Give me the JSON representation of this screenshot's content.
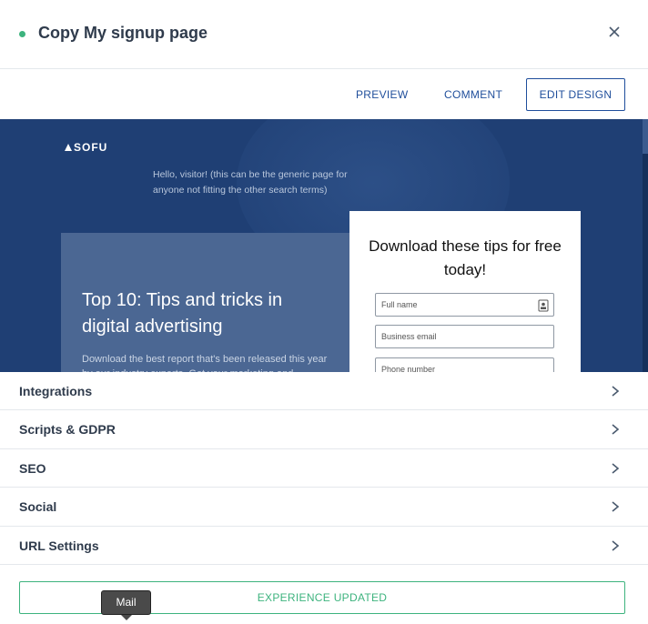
{
  "header": {
    "title": "Copy My signup page",
    "status_color": "#3db37e",
    "close_icon": "close-icon"
  },
  "actions": {
    "preview_label": "PREVIEW",
    "comment_label": "COMMENT",
    "edit_design_label": "EDIT DESIGN"
  },
  "preview": {
    "logo_text": "SOFU",
    "greeting": "Hello, visitor! (this can be the generic page for anyone not fitting the other search terms)",
    "hero_title": "Top 10: Tips and tricks in digital advertising",
    "hero_text": "Download the best report that's been released this year by our industry experts. Get your marketing and",
    "form_title": "Download these tips for free today!",
    "fields": {
      "full_name": "Full name",
      "business_email": "Business email",
      "phone_number": "Phone number"
    },
    "background_color": "#1f3f74"
  },
  "settings": {
    "items": [
      {
        "label": "Integrations"
      },
      {
        "label": "Scripts & GDPR"
      },
      {
        "label": "SEO"
      },
      {
        "label": "Social"
      },
      {
        "label": "URL Settings"
      }
    ]
  },
  "footer": {
    "status_label": "EXPERIENCE UPDATED",
    "accent_color": "#3db37e"
  },
  "tooltip": {
    "label": "Mail"
  }
}
